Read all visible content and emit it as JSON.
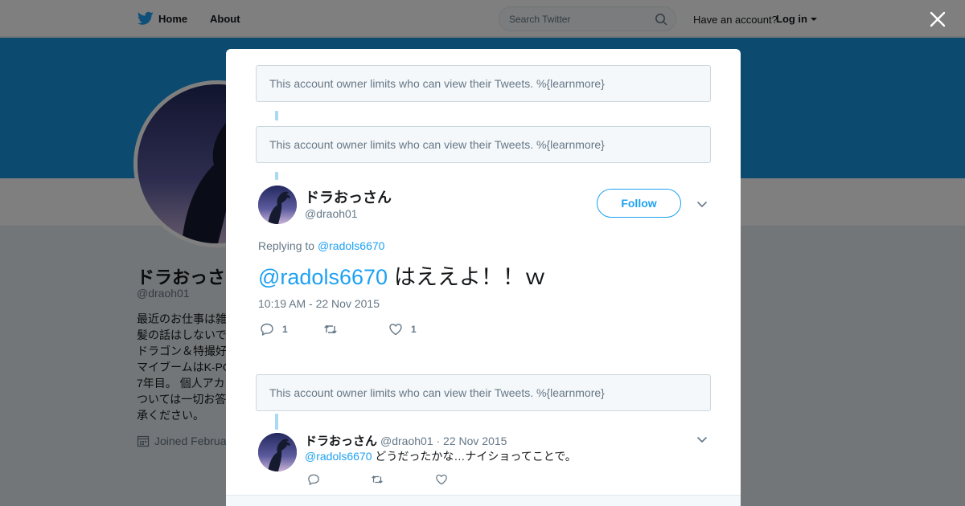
{
  "topbar": {
    "home_label": "Home",
    "about_label": "About",
    "search_placeholder": "Search Twitter",
    "have_account_label": "Have an account?",
    "login_label": "Log in"
  },
  "profile": {
    "name": "ドラおっさ",
    "handle": "@draoh01",
    "bio_lines": [
      "最近のお仕事は雑",
      "髪の話はしないで",
      "ドラゴン＆特撮好",
      "マイブームはK-PO",
      "7年目。 個人アカ",
      "ついては一切お答",
      "承ください。"
    ],
    "joined": "Joined Februa"
  },
  "modal": {
    "notice_text": "This account owner limits who can view their Tweets. %{learnmore}",
    "main_tweet": {
      "name": "ドラおっさん",
      "handle": "@draoh01",
      "follow_label": "Follow",
      "replying_prefix": "Replying to",
      "replying_to": "@radols6670",
      "mention": "@radols6670",
      "text": "はええよ！！ｗ",
      "timestamp": "10:19 AM - 22 Nov 2015",
      "reply_count": "1",
      "like_count": "1"
    },
    "reply_tweet": {
      "name": "ドラおっさん",
      "meta": "@draoh01 · 22 Nov 2015",
      "mention": "@radols6670",
      "text": "どうだったかな…ナイショってことで。"
    }
  },
  "colors": {
    "accent": "#1da1f2",
    "banner": "#1b95e0",
    "thread_line": "#a8daf5"
  },
  "icons": [
    "twitter-bird-icon",
    "search-icon",
    "caret-down-icon",
    "close-icon",
    "calendar-icon",
    "chevron-down-icon",
    "reply-icon",
    "retweet-icon",
    "heart-icon"
  ]
}
